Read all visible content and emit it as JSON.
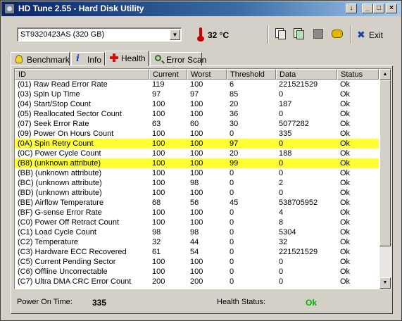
{
  "window": {
    "title": "HD Tune 2.55 - Hard Disk Utility",
    "buttons": {
      "minimize_alt": "↓",
      "minimize": "_",
      "maximize": "□",
      "close": "×"
    }
  },
  "toolbar": {
    "drive": "ST9320423AS (320 GB)",
    "temperature": "32 °C",
    "exit_label": "Exit",
    "icons": [
      "copy-text-icon",
      "copy-screenshot-icon",
      "save-icon",
      "options-icon"
    ]
  },
  "tabs": [
    {
      "label": "Benchmark",
      "icon": "benchmark-icon"
    },
    {
      "label": "Info",
      "icon": "info-icon"
    },
    {
      "label": "Health",
      "icon": "health-icon",
      "active": true
    },
    {
      "label": "Error Scan",
      "icon": "error-scan-icon"
    }
  ],
  "table": {
    "columns": [
      "ID",
      "Current",
      "Worst",
      "Threshold",
      "Data",
      "Status"
    ],
    "rows": [
      {
        "id": "(01) Raw Read Error Rate",
        "current": "119",
        "worst": "100",
        "threshold": "6",
        "data": "221521529",
        "status": "Ok"
      },
      {
        "id": "(03) Spin Up Time",
        "current": "97",
        "worst": "97",
        "threshold": "85",
        "data": "0",
        "status": "Ok"
      },
      {
        "id": "(04) Start/Stop Count",
        "current": "100",
        "worst": "100",
        "threshold": "20",
        "data": "187",
        "status": "Ok"
      },
      {
        "id": "(05) Reallocated Sector Count",
        "current": "100",
        "worst": "100",
        "threshold": "36",
        "data": "0",
        "status": "Ok"
      },
      {
        "id": "(07) Seek Error Rate",
        "current": "63",
        "worst": "60",
        "threshold": "30",
        "data": "5077282",
        "status": "Ok"
      },
      {
        "id": "(09) Power On Hours Count",
        "current": "100",
        "worst": "100",
        "threshold": "0",
        "data": "335",
        "status": "Ok"
      },
      {
        "id": "(0A) Spin Retry Count",
        "current": "100",
        "worst": "100",
        "threshold": "97",
        "data": "0",
        "status": "Ok",
        "highlight": true
      },
      {
        "id": "(0C) Power Cycle Count",
        "current": "100",
        "worst": "100",
        "threshold": "20",
        "data": "188",
        "status": "Ok"
      },
      {
        "id": "(B8) (unknown attribute)",
        "current": "100",
        "worst": "100",
        "threshold": "99",
        "data": "0",
        "status": "Ok",
        "highlight": true
      },
      {
        "id": "(BB) (unknown attribute)",
        "current": "100",
        "worst": "100",
        "threshold": "0",
        "data": "0",
        "status": "Ok"
      },
      {
        "id": "(BC) (unknown attribute)",
        "current": "100",
        "worst": "98",
        "threshold": "0",
        "data": "2",
        "status": "Ok"
      },
      {
        "id": "(BD) (unknown attribute)",
        "current": "100",
        "worst": "100",
        "threshold": "0",
        "data": "0",
        "status": "Ok"
      },
      {
        "id": "(BE) Airflow Temperature",
        "current": "68",
        "worst": "56",
        "threshold": "45",
        "data": "538705952",
        "status": "Ok"
      },
      {
        "id": "(BF) G-sense Error Rate",
        "current": "100",
        "worst": "100",
        "threshold": "0",
        "data": "4",
        "status": "Ok"
      },
      {
        "id": "(C0) Power Off Retract Count",
        "current": "100",
        "worst": "100",
        "threshold": "0",
        "data": "8",
        "status": "Ok"
      },
      {
        "id": "(C1) Load Cycle Count",
        "current": "98",
        "worst": "98",
        "threshold": "0",
        "data": "5304",
        "status": "Ok"
      },
      {
        "id": "(C2) Temperature",
        "current": "32",
        "worst": "44",
        "threshold": "0",
        "data": "32",
        "status": "Ok"
      },
      {
        "id": "(C3) Hardware ECC Recovered",
        "current": "61",
        "worst": "54",
        "threshold": "0",
        "data": "221521529",
        "status": "Ok"
      },
      {
        "id": "(C5) Current Pending Sector",
        "current": "100",
        "worst": "100",
        "threshold": "0",
        "data": "0",
        "status": "Ok"
      },
      {
        "id": "(C6) Offline Uncorrectable",
        "current": "100",
        "worst": "100",
        "threshold": "0",
        "data": "0",
        "status": "Ok"
      },
      {
        "id": "(C7) Ultra DMA CRC Error Count",
        "current": "200",
        "worst": "200",
        "threshold": "0",
        "data": "0",
        "status": "Ok"
      }
    ]
  },
  "status_bar": {
    "power_on_label": "Power On Time:",
    "power_on_value": "335",
    "health_label": "Health Status:",
    "health_value": "Ok"
  },
  "colors": {
    "highlight": "#ffff33",
    "health_ok": "#00b000",
    "titlebar": "#0a246a"
  }
}
